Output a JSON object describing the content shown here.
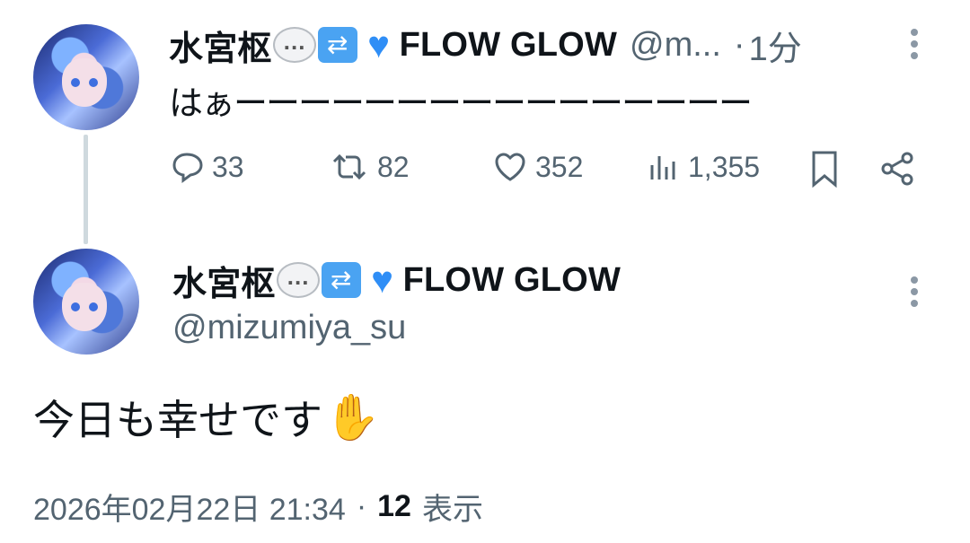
{
  "tweet1": {
    "author_name": "水宮枢",
    "author_suffix": "FLOW GLOW",
    "handle": "@m...",
    "separator": "·",
    "time_ago": "1分",
    "text": "はぁーーーーーーーーーーーーーーーー",
    "stats": {
      "replies": "33",
      "retweets": "82",
      "likes": "352",
      "views": "1,355"
    }
  },
  "tweet2": {
    "author_name": "水宮枢",
    "author_suffix": "FLOW GLOW",
    "handle": "@mizumiya_su",
    "text": "今日も幸せです",
    "timestamp": "2026年02月22日 21:34",
    "separator": "·",
    "views_count": "12",
    "views_label": "表示"
  },
  "emoji": {
    "speech": "…",
    "repeat": "⇄",
    "heart": "♥",
    "hand": "✋"
  },
  "colors": {
    "text": "#0f1419",
    "secondary": "#536471",
    "thread_line": "#cfd9de",
    "heart_emoji": "#2f8ef6"
  }
}
